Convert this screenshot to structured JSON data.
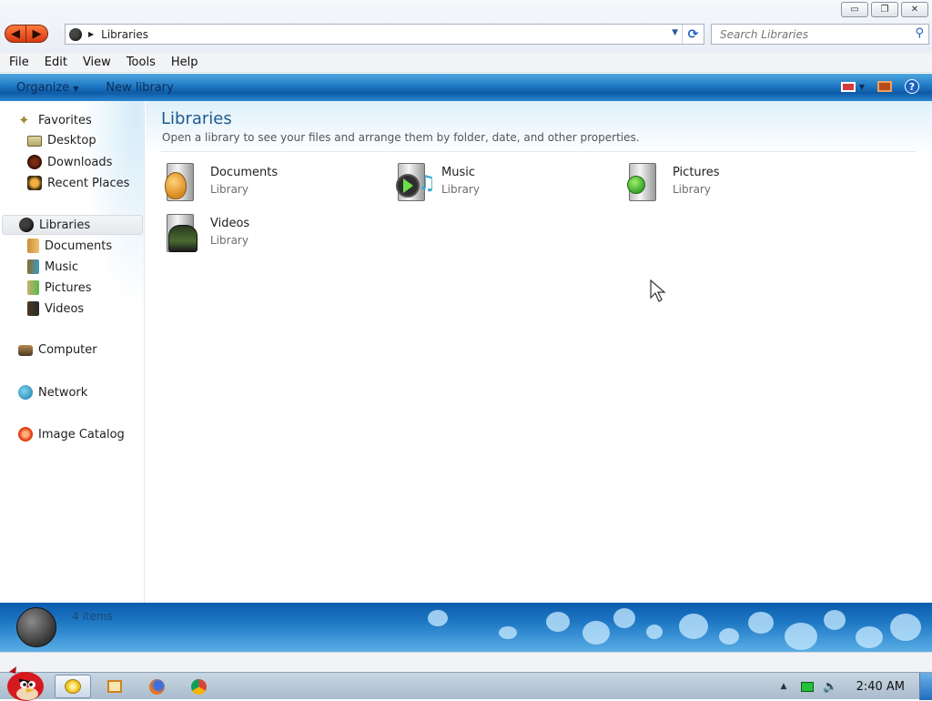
{
  "window": {
    "controls": {
      "minimize": "▭",
      "restore": "❐",
      "close": "✕"
    }
  },
  "address": {
    "crumb": "Libraries",
    "search_placeholder": "Search Libraries"
  },
  "menu": [
    "File",
    "Edit",
    "View",
    "Tools",
    "Help"
  ],
  "commands": {
    "organize": "Organize",
    "new_library": "New library",
    "help_glyph": "?"
  },
  "nav": {
    "favorites": "Favorites",
    "favorites_items": [
      "Desktop",
      "Downloads",
      "Recent Places"
    ],
    "libraries": "Libraries",
    "libraries_items": [
      "Documents",
      "Music",
      "Pictures",
      "Videos"
    ],
    "computer": "Computer",
    "network": "Network",
    "image_catalog": "Image Catalog"
  },
  "content": {
    "title": "Libraries",
    "subtitle": "Open a library to see your files and arrange them by folder, date, and other properties.",
    "libraries": [
      {
        "name": "Documents",
        "type": "Library"
      },
      {
        "name": "Music",
        "type": "Library"
      },
      {
        "name": "Pictures",
        "type": "Library"
      },
      {
        "name": "Videos",
        "type": "Library"
      }
    ]
  },
  "details": {
    "count": "4 items"
  },
  "taskbar": {
    "clock": "2:40 AM"
  },
  "colors": {
    "accent": "#1f78c4",
    "title": "#1e5a8e",
    "subtext": "#6d6d6d"
  }
}
